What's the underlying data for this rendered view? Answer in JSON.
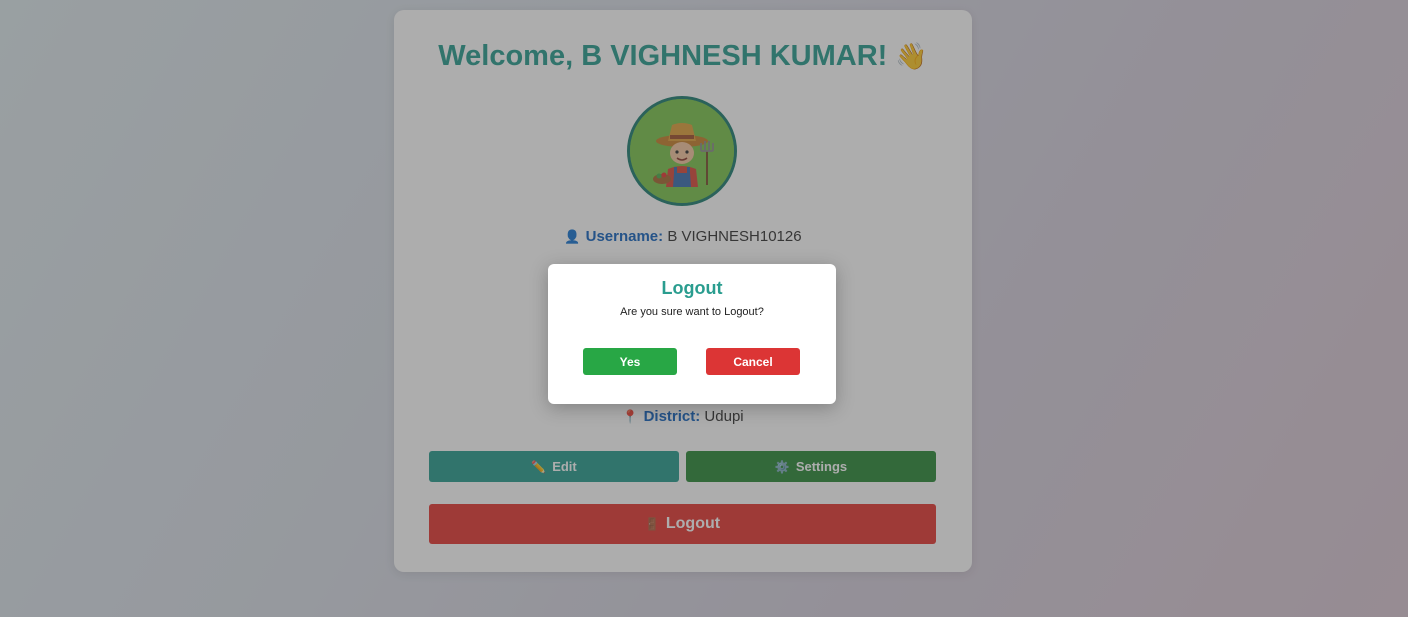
{
  "profile": {
    "welcome_text": "Welcome, B VIGHNESH KUMAR!",
    "wave_emoji": "👋",
    "username_label": "Username:",
    "username_value": "B VIGHNESH10126",
    "district_label": "District:",
    "district_value": "Udupi",
    "user_icon": "👤",
    "pin_icon": "📍"
  },
  "actions": {
    "edit_label": "Edit",
    "edit_icon": "✏️",
    "settings_label": "Settings",
    "settings_icon": "⚙️",
    "logout_label": "Logout",
    "logout_icon": "🚪"
  },
  "dialog": {
    "title": "Logout",
    "message": "Are you sure want to Logout?",
    "yes_label": "Yes",
    "cancel_label": "Cancel"
  },
  "colors": {
    "accent": "#2a9d8f",
    "label_blue": "#1565c0",
    "confirm_green": "#28a745",
    "danger_red": "#dc3535"
  }
}
